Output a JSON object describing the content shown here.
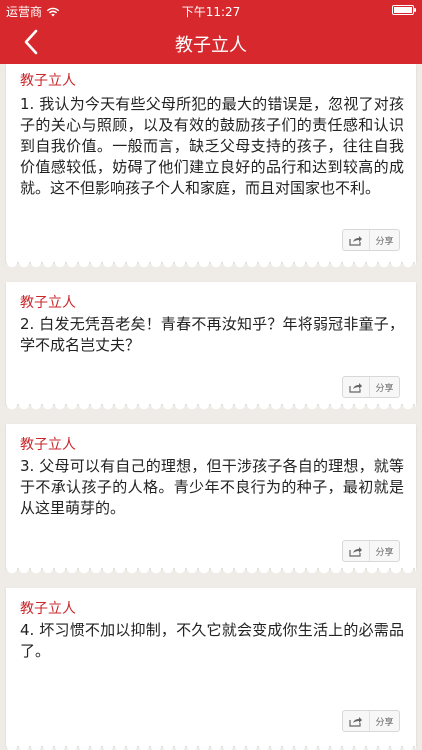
{
  "status_bar": {
    "carrier": "运营商",
    "time": "下午11:27"
  },
  "nav": {
    "title": "教子立人"
  },
  "cards": [
    {
      "heading": "教子立人",
      "text": "1. 我认为今天有些父母所犯的最大的错误是，忽视了对孩子的关心与照顾，以及有效的鼓励孩子们的责任感和认识到自我价值。一般而言，缺乏父母支持的孩子，往往自我价值感较低，妨碍了他们建立良好的品行和达到较高的成就。这不但影响孩子个人和家庭，而且对国家也不利。",
      "share_label": "分享"
    },
    {
      "heading": "教子立人",
      "text": "2. 白发无凭吾老矣！青春不再汝知乎？年将弱冠非童子，学不成名岂丈夫？",
      "share_label": "分享"
    },
    {
      "heading": "教子立人",
      "text": "3. 父母可以有自己的理想，但干涉孩子各自的理想，就等于不承认孩子的人格。青少年不良行为的种子，最初就是从这里萌芽的。",
      "share_label": "分享"
    },
    {
      "heading": "教子立人",
      "text": "4. 坏习惯不加以抑制，不久它就会变成你生活上的必需品了。",
      "share_label": "分享"
    }
  ],
  "colors": {
    "accent": "#d7292d",
    "heading": "#c9282c",
    "background": "#efece7"
  },
  "icons": {
    "back": "chevron-left-icon",
    "share": "share-icon",
    "wifi": "wifi-icon",
    "battery": "battery-icon"
  }
}
